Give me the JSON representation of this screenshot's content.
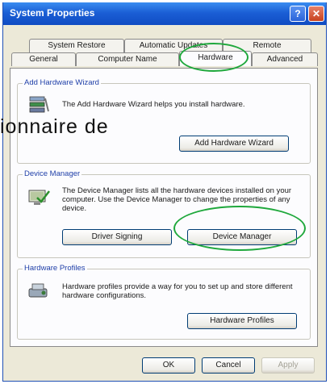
{
  "window": {
    "title": "System Properties"
  },
  "titlebar": {
    "help_label": "?",
    "close_label": "✕"
  },
  "tabs": {
    "row1": [
      {
        "label": "System Restore"
      },
      {
        "label": "Automatic Updates"
      },
      {
        "label": "Remote"
      }
    ],
    "row2": [
      {
        "label": "General"
      },
      {
        "label": "Computer Name"
      },
      {
        "label": "Hardware",
        "selected": true
      },
      {
        "label": "Advanced"
      }
    ]
  },
  "groups": {
    "add_hardware": {
      "title": "Add Hardware Wizard",
      "description": "The Add Hardware Wizard helps you install hardware.",
      "button": "Add Hardware Wizard",
      "icon": "add-hardware-icon"
    },
    "device_manager": {
      "title": "Device Manager",
      "description": "The Device Manager lists all the hardware devices installed on your computer. Use the Device Manager to change the properties of any device.",
      "button_signing": "Driver Signing",
      "button_manager": "Device Manager",
      "icon": "device-manager-icon"
    },
    "hardware_profiles": {
      "title": "Hardware Profiles",
      "description": "Hardware profiles provide a way for you to set up and store different hardware configurations.",
      "button": "Hardware Profiles",
      "icon": "hardware-profiles-icon"
    }
  },
  "footer": {
    "ok": "OK",
    "cancel": "Cancel",
    "apply": "Apply"
  },
  "overlay": {
    "text": "ionnaire de"
  },
  "colors": {
    "highlight": "#1fa83c",
    "titlebar": "#1b5fd6"
  }
}
